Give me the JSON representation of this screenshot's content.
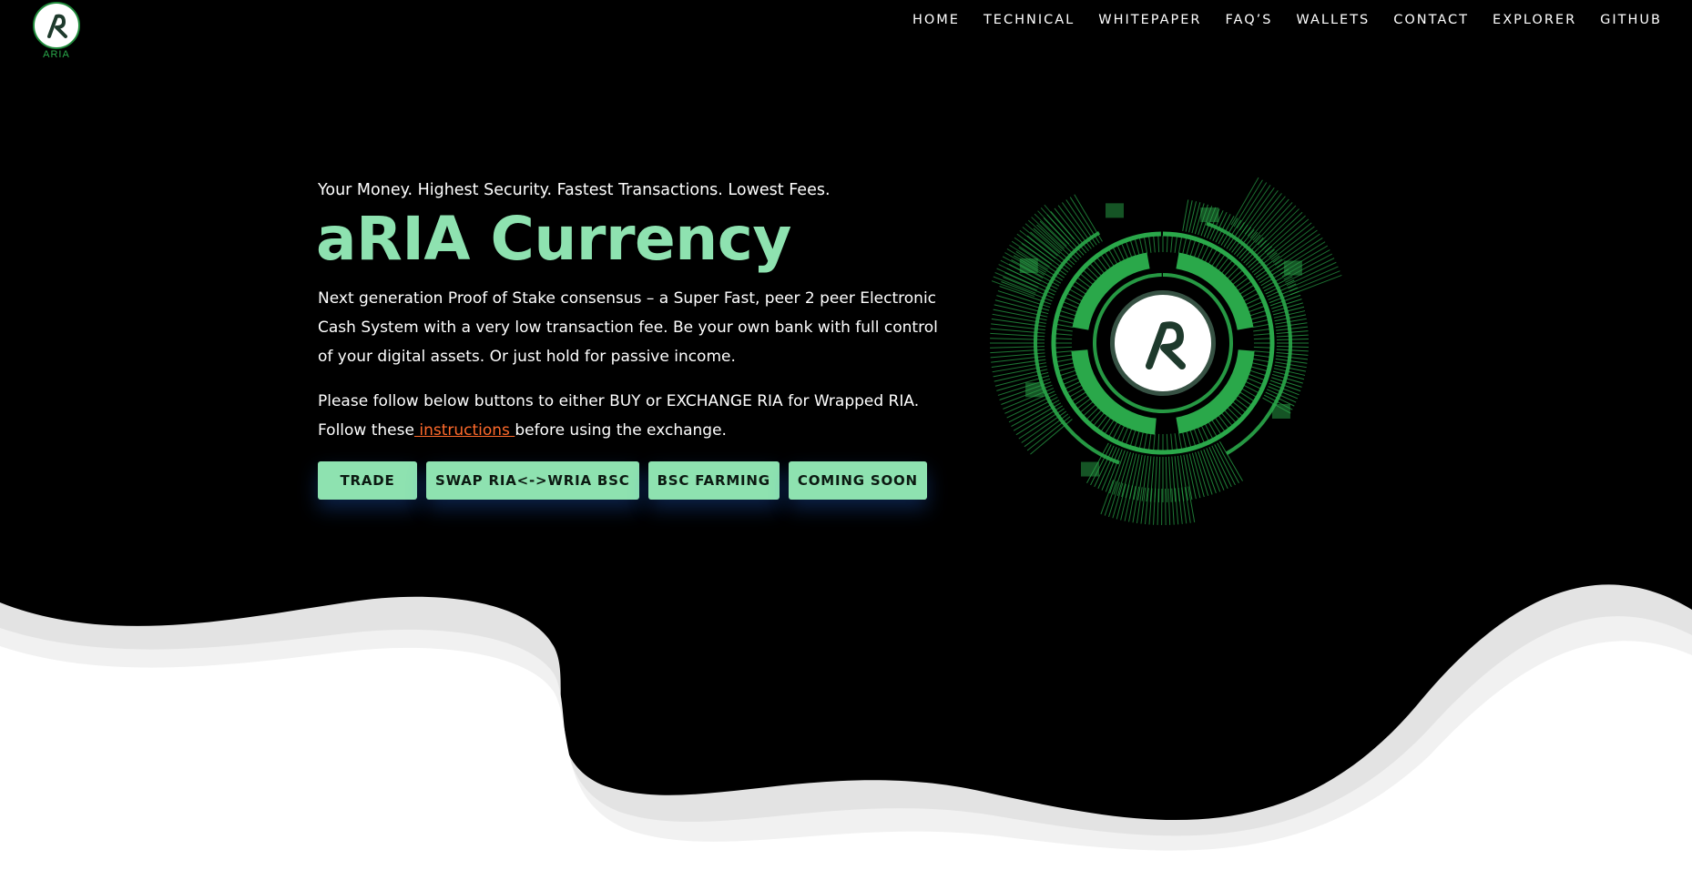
{
  "header": {
    "logo_text": "ARIA",
    "nav": [
      "HOME",
      "TECHNICAL",
      "WHITEPAPER",
      "FAQ’S",
      "WALLETS",
      "CONTACT",
      "EXPLORER",
      "GITHUB"
    ]
  },
  "hero": {
    "tagline": "Your Money. Highest Security. Fastest Transactions. Lowest Fees.",
    "title": "aRIA Currency",
    "description": "Next generation Proof of Stake consensus – a Super Fast, peer 2 peer Electronic Cash System with a very low transaction fee. Be your own bank with full control of your digital assets. Or just hold for passive income.",
    "note_before": "Please follow below buttons to either BUY or EXCHANGE RIA for Wrapped RIA. Follow these",
    "note_link": " instructions ",
    "note_after": "before using the exchange.",
    "buttons": [
      "TRADE",
      "SWAP RIA<->WRIA BSC",
      "BSC FARMING",
      "COMING SOON"
    ]
  },
  "colors": {
    "background": "#000000",
    "accent_green": "#8ee2b0",
    "link_orange": "#ff6a2b",
    "ring_green": "#2aa84a"
  }
}
